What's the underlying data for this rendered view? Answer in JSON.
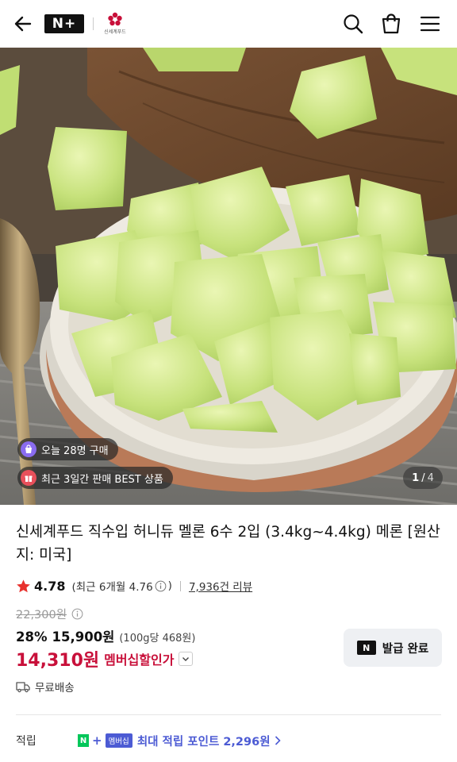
{
  "header": {
    "brand_badge": "N+",
    "store_logo_text": "신세계푸드",
    "colors": {
      "brand_red": "#c8103a"
    }
  },
  "hero": {
    "chips": [
      {
        "icon": "bag-icon",
        "text": "오늘 28명 구매",
        "icon_color": "#8a6cf0"
      },
      {
        "icon": "gift-icon",
        "text": "최근 3일간 판매 BEST 상품",
        "icon_color": "#e8505b"
      }
    ],
    "counter": {
      "current": "1",
      "separator": "/",
      "total": "4"
    }
  },
  "product": {
    "title": "신세계푸드 직수입 허니듀 멜론 6수 2입 (3.4kg~4.4kg) 메론 [원산지: 미국]",
    "rating": {
      "score": "4.78",
      "recent_label": "(최근 6개월 4.76",
      "recent_close": ")",
      "reviews": "7,936건 리뷰"
    },
    "price": {
      "original": "22,300원",
      "discount_rate": "28%",
      "discount_price": "15,900원",
      "unit_price": "(100g당 468원)",
      "member_price": "14,310원",
      "member_label": "멤버십할인가"
    },
    "coupon_button": {
      "badge": "N",
      "label": "발급 완료"
    },
    "shipping": "무료배송",
    "points": {
      "label": "적립",
      "badge_n": "N",
      "badge_plus": "+",
      "badge_member": "멤버십",
      "text": "최대 적립 포인트 2,296원"
    }
  }
}
